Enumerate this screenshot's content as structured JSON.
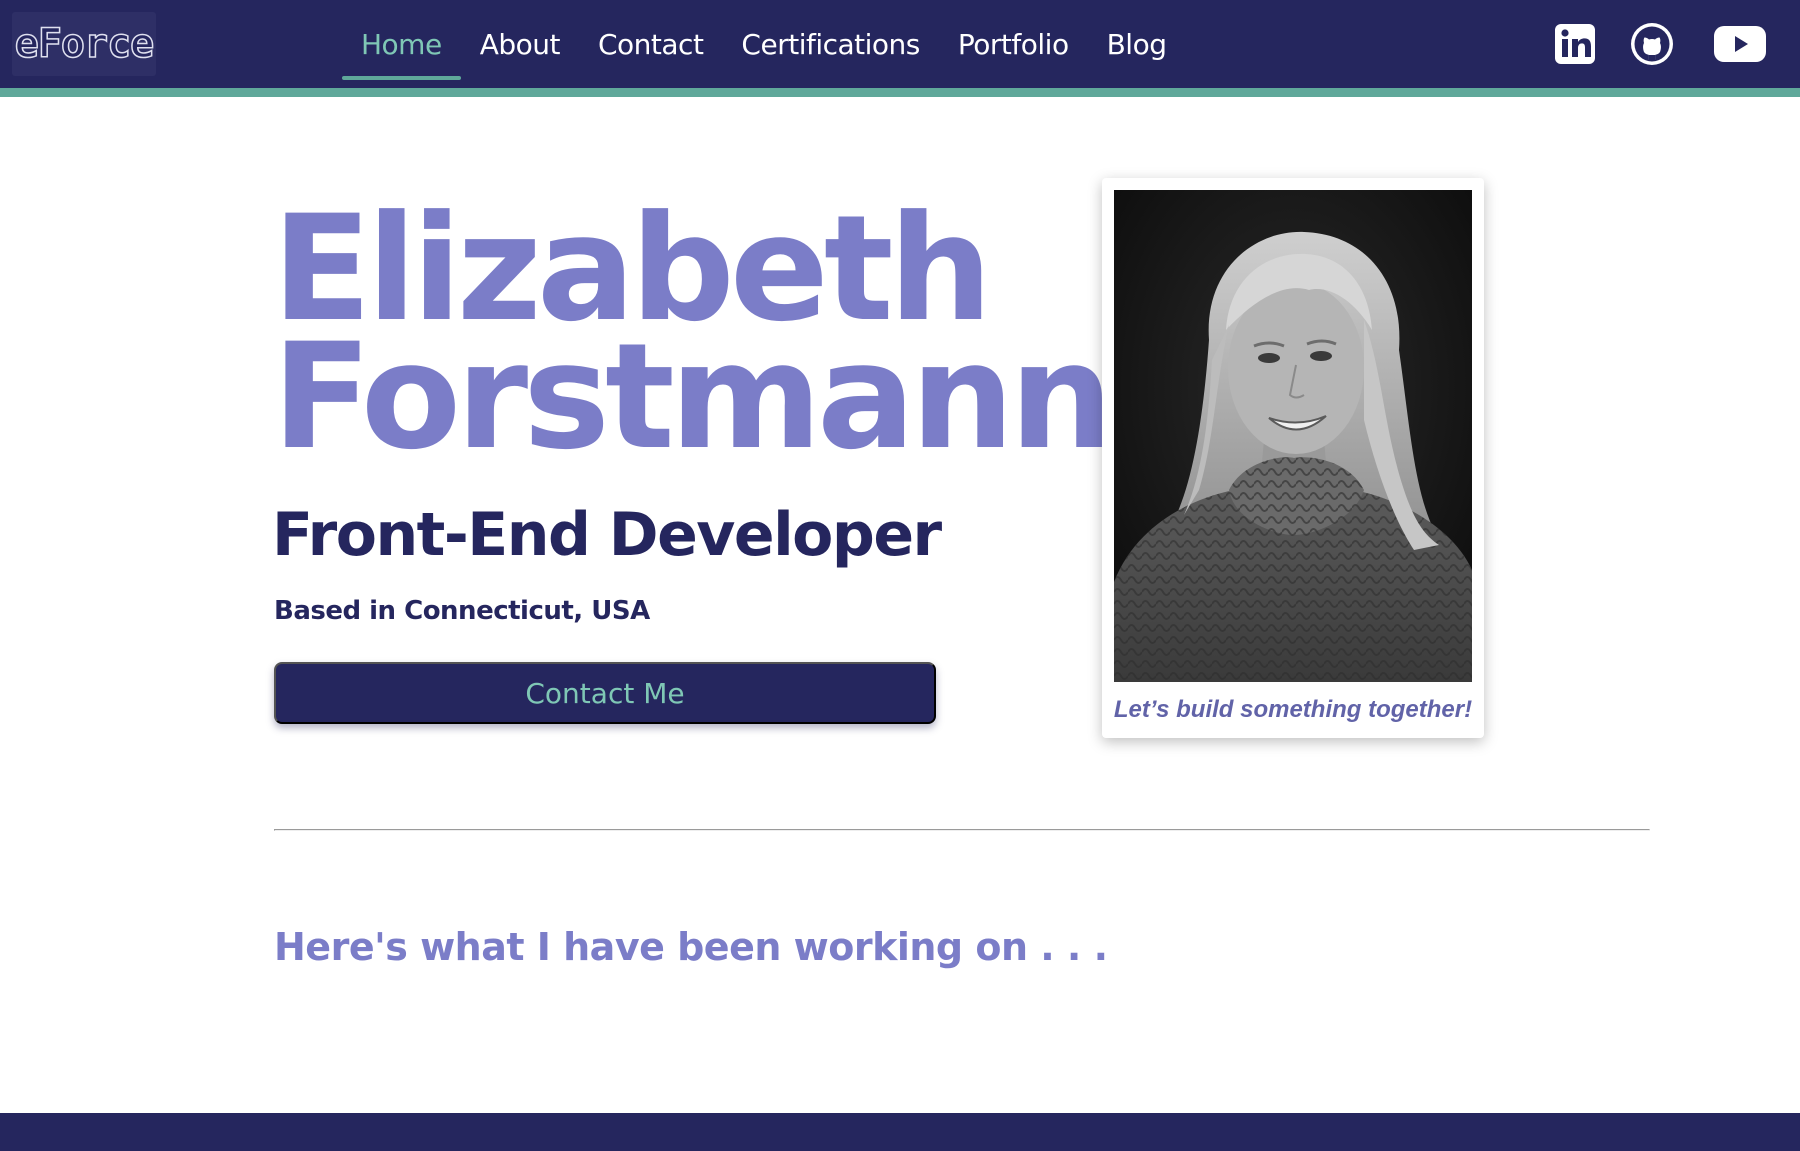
{
  "nav": {
    "logo": "eForce",
    "links": [
      {
        "label": "Home",
        "active": true
      },
      {
        "label": "About",
        "active": false
      },
      {
        "label": "Contact",
        "active": false
      },
      {
        "label": "Certifications",
        "active": false
      },
      {
        "label": "Portfolio",
        "active": false
      },
      {
        "label": "Blog",
        "active": false
      }
    ],
    "social_icons": [
      "linkedin-icon",
      "github-icon",
      "youtube-icon"
    ]
  },
  "hero": {
    "first_name": "Elizabeth",
    "last_name": "Forstmann",
    "role": "Front-End Developer",
    "location": "Based in Connecticut, USA",
    "cta": "Contact Me"
  },
  "photo_card": {
    "caption": "Let’s build something together!"
  },
  "section": {
    "heading": "Here's what I have been working on . . ."
  },
  "colors": {
    "navy": "#25265e",
    "accent_teal": "#5fa89a",
    "teal_text": "#7fc7b5",
    "lavender": "#7b7dc8"
  }
}
